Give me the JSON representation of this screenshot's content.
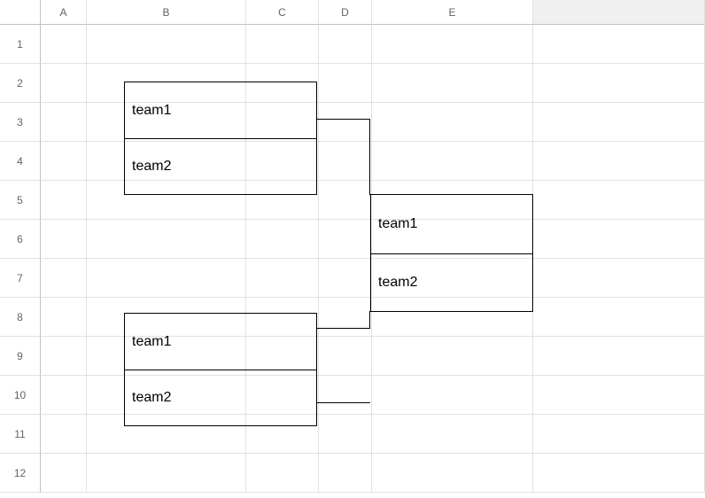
{
  "columns": [
    "A",
    "B",
    "C",
    "D",
    "E",
    ""
  ],
  "rows": [
    "1",
    "2",
    "3",
    "4",
    "5",
    "6",
    "7",
    "8",
    "9",
    "10",
    "11",
    "12"
  ],
  "bracket": {
    "match1": {
      "team1": "team1",
      "team2": "team2"
    },
    "match2": {
      "team1": "team1",
      "team2": "team2"
    },
    "final": {
      "team1": "team1",
      "team2": "team2"
    }
  }
}
